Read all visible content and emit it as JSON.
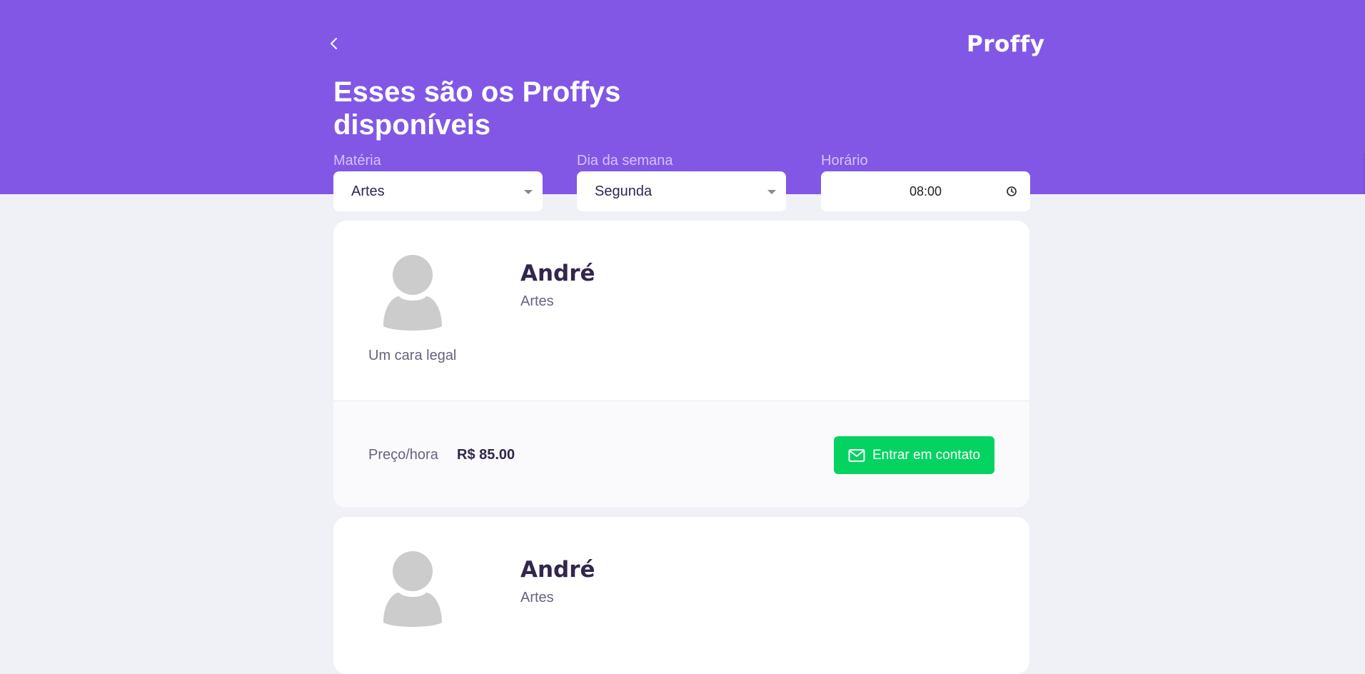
{
  "header": {
    "back_icon": "chevron-left-icon",
    "logo": "Proffy",
    "title": "Esses são os Proffys disponíveis",
    "background_color": "#8257e5"
  },
  "filters": {
    "subject": {
      "label": "Matéria",
      "value": "Artes"
    },
    "weekday": {
      "label": "Dia da semana",
      "value": "Segunda"
    },
    "time": {
      "label": "Horário",
      "value": "08:00"
    }
  },
  "teachers": [
    {
      "name": "André",
      "subject": "Artes",
      "bio": "Um cara legal",
      "price_label": "Preço/hora",
      "price": "R$ 85.00",
      "contact_label": "Entrar em contato"
    },
    {
      "name": "André",
      "subject": "Artes"
    }
  ],
  "colors": {
    "accent": "#8257e5",
    "contact_button": "#04d361",
    "title_text": "#32264d",
    "body_text": "#6a6180",
    "page_background": "#f0f0f7"
  }
}
